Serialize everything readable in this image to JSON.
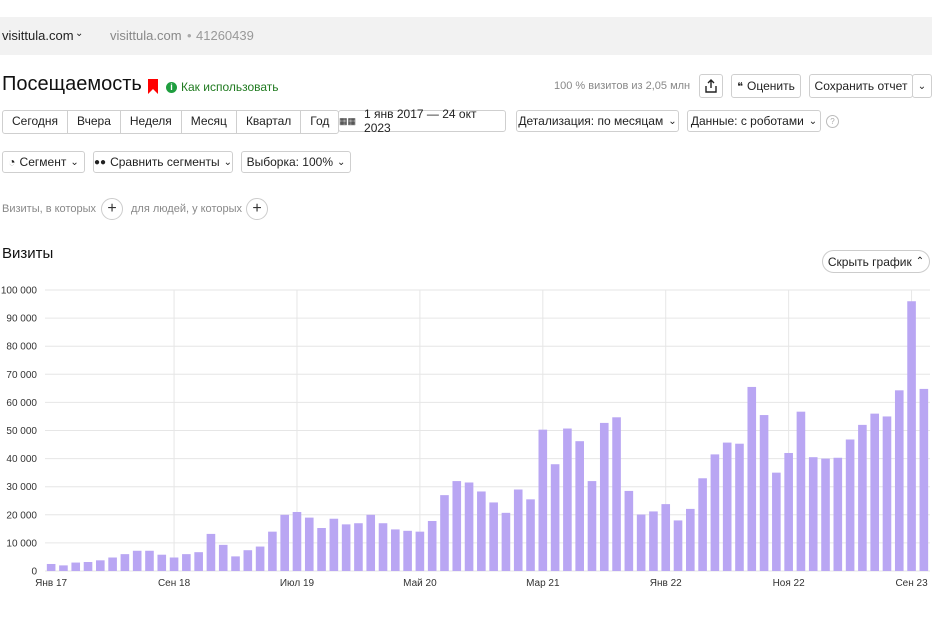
{
  "topbar": {
    "site": "visittula.com",
    "site_secondary": "visittula.com",
    "dot": "•",
    "counter_id": "41260439"
  },
  "header": {
    "title": "Посещаемость",
    "howto": "Как использовать",
    "howto_icon": "i",
    "visits_meta": "100 % визитов из 2,05 млн",
    "rate_label": "Оценить",
    "save_label": "Сохранить отчет"
  },
  "periods": [
    "Сегодня",
    "Вчера",
    "Неделя",
    "Месяц",
    "Квартал",
    "Год"
  ],
  "daterange": "1 янв 2017 — 24 окт 2023",
  "detail": "Детализация: по месяцам",
  "robots": "Данные: с роботами",
  "help_icon": "?",
  "segment": "Сегмент",
  "compare": "Сравнить сегменты",
  "sample": "Выборка: 100%",
  "filters": {
    "left": "Визиты, в которых",
    "right": "для людей, у которых"
  },
  "chart_section": {
    "title": "Визиты",
    "hide_label": "Скрыть график"
  },
  "colors": {
    "bar": "#b9a6f3",
    "grid": "#e6e6e6",
    "howto": "#1f7a1f",
    "bookmark": "#ff0000"
  },
  "chart_data": {
    "type": "bar",
    "ylabel": "",
    "ylim": [
      0,
      100000
    ],
    "yticks": [
      "0",
      "10 000",
      "20 000",
      "30 000",
      "40 000",
      "50 000",
      "60 000",
      "70 000",
      "80 000",
      "90 000",
      "100 000"
    ],
    "xtick_labels": [
      {
        "index": 0,
        "label": "Янв 17"
      },
      {
        "index": 10,
        "label": "Сен 18"
      },
      {
        "index": 20,
        "label": "Июл 19"
      },
      {
        "index": 30,
        "label": "Май 20"
      },
      {
        "index": 40,
        "label": "Мар 21"
      },
      {
        "index": 50,
        "label": "Янв 22"
      },
      {
        "index": 60,
        "label": "Ноя 22"
      },
      {
        "index": 70,
        "label": "Сен 23"
      }
    ],
    "values": [
      2500,
      2000,
      3000,
      3200,
      3800,
      4800,
      6000,
      7200,
      7200,
      5800,
      4800,
      6000,
      6700,
      13200,
      9300,
      5200,
      7400,
      8700,
      14000,
      20000,
      21000,
      19000,
      15300,
      18600,
      16600,
      17000,
      20000,
      17000,
      14800,
      14300,
      14000,
      17800,
      27000,
      32000,
      31500,
      28300,
      24400,
      20700,
      29000,
      25500,
      50300,
      38000,
      50700,
      46200,
      32000,
      52700,
      54700,
      28500,
      20100,
      21200,
      23800,
      18000,
      22100,
      33000,
      41500,
      45700,
      45300,
      65500,
      55500,
      35000,
      42000,
      56700,
      40500,
      40000,
      40300,
      46800,
      52000,
      56000,
      55000,
      64300,
      96000,
      64800
    ]
  }
}
